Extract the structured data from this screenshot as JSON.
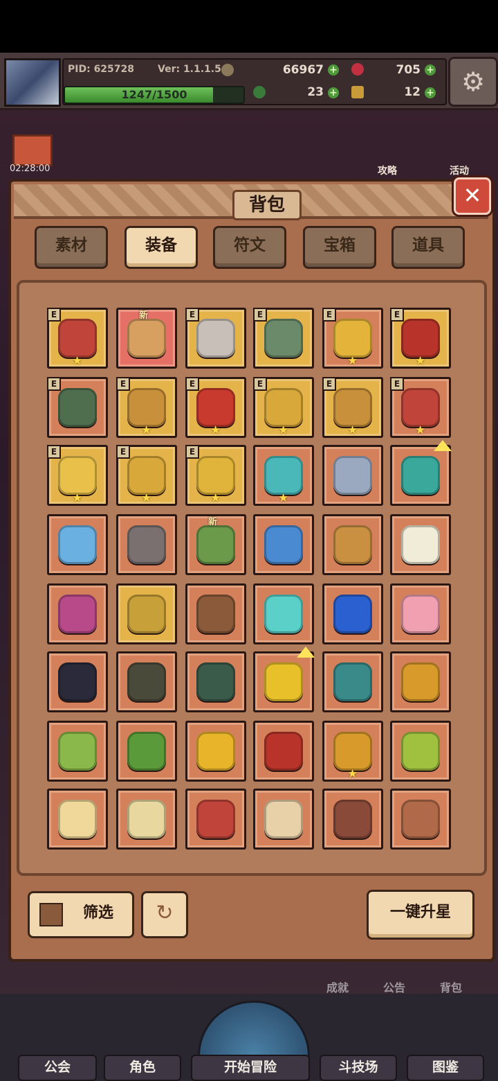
{
  "status": {
    "pid": "PID: 625728",
    "version": "Ver: 1.1.1.5",
    "gold": "66967",
    "gems": "705",
    "clover": "23",
    "keys": "12",
    "exp_text": "1247/1500",
    "exp_progress": 0.831
  },
  "hud": {
    "timer": "02:28:00",
    "guide": "攻略",
    "event": "活动"
  },
  "bag": {
    "title": "背包",
    "close_symbol": "✕"
  },
  "tabs": [
    {
      "label": "素材",
      "active": false
    },
    {
      "label": "装备",
      "active": true
    },
    {
      "label": "符文",
      "active": false
    },
    {
      "label": "宝箱",
      "active": false
    },
    {
      "label": "道具",
      "active": false
    }
  ],
  "items": [
    {
      "rarity": "gold",
      "icon": "helmet-red-icon",
      "color": "#c0443a",
      "e": true,
      "new": false,
      "star": true,
      "up": false
    },
    {
      "rarity": "pink",
      "icon": "ring-icon",
      "color": "#d8a060",
      "e": false,
      "new": true,
      "star": false,
      "up": false
    },
    {
      "rarity": "gold",
      "icon": "axe-icon",
      "color": "#c8c0b8",
      "e": true,
      "new": false,
      "star": false,
      "up": false
    },
    {
      "rarity": "gold",
      "icon": "orb-green-icon",
      "color": "#6a8a6a",
      "e": true,
      "new": false,
      "star": false,
      "up": false
    },
    {
      "rarity": "orange",
      "icon": "crown-ring-icon",
      "color": "#e4b43a",
      "e": true,
      "new": false,
      "star": true,
      "up": false
    },
    {
      "rarity": "gold",
      "icon": "cape-red-icon",
      "color": "#b8342a",
      "e": true,
      "new": false,
      "star": true,
      "up": false
    },
    {
      "rarity": "orange",
      "icon": "armor-green-icon",
      "color": "#4e6e4e",
      "e": true,
      "new": false,
      "star": false,
      "up": false
    },
    {
      "rarity": "gold",
      "icon": "scepter-icon",
      "color": "#c8903a",
      "e": true,
      "new": false,
      "star": true,
      "up": false
    },
    {
      "rarity": "gold",
      "icon": "gauntlet-icon",
      "color": "#c83a2e",
      "e": true,
      "new": false,
      "star": true,
      "up": false
    },
    {
      "rarity": "gold",
      "icon": "necklace-icon",
      "color": "#d8a83a",
      "e": true,
      "new": false,
      "star": true,
      "up": false
    },
    {
      "rarity": "gold",
      "icon": "boots-gold-icon",
      "color": "#c8903a",
      "e": true,
      "new": false,
      "star": true,
      "up": false
    },
    {
      "rarity": "orange",
      "icon": "boots-red-icon",
      "color": "#c0443a",
      "e": true,
      "new": false,
      "star": true,
      "up": false
    },
    {
      "rarity": "gold",
      "icon": "amulet-icon",
      "color": "#e8c04a",
      "e": true,
      "new": false,
      "star": true,
      "up": false
    },
    {
      "rarity": "gold",
      "icon": "pendant-icon",
      "color": "#d8a83a",
      "e": true,
      "new": false,
      "star": true,
      "up": false
    },
    {
      "rarity": "gold",
      "icon": "gem-ring-icon",
      "color": "#e0b43a",
      "e": true,
      "new": false,
      "star": true,
      "up": false
    },
    {
      "rarity": "orange",
      "icon": "staff-teal-icon",
      "color": "#4ab8b8",
      "e": false,
      "new": false,
      "star": true,
      "up": false
    },
    {
      "rarity": "orange",
      "icon": "crossed-swords-icon",
      "color": "#9aa8c0",
      "e": false,
      "new": false,
      "star": false,
      "up": false
    },
    {
      "rarity": "orange",
      "icon": "bow-icon",
      "color": "#3aa89a",
      "e": false,
      "new": false,
      "star": false,
      "up": true
    },
    {
      "rarity": "orange",
      "icon": "wand-blue-icon",
      "color": "#6ab0e0",
      "e": false,
      "new": false,
      "star": false,
      "up": false
    },
    {
      "rarity": "orange",
      "icon": "crossbow-icon",
      "color": "#7a7070",
      "e": false,
      "new": false,
      "star": false,
      "up": false
    },
    {
      "rarity": "orange",
      "icon": "leaf-blade-icon",
      "color": "#6a9a4a",
      "e": false,
      "new": true,
      "star": false,
      "up": false
    },
    {
      "rarity": "orange",
      "icon": "wand-gem-icon",
      "color": "#4a8ad0",
      "e": false,
      "new": false,
      "star": false,
      "up": false
    },
    {
      "rarity": "orange",
      "icon": "spear-icon",
      "color": "#c89040",
      "e": false,
      "new": false,
      "star": false,
      "up": false
    },
    {
      "rarity": "orange",
      "icon": "shield-white-icon",
      "color": "#f0ecd8",
      "e": false,
      "new": false,
      "star": false,
      "up": false
    },
    {
      "rarity": "orange",
      "icon": "flower-shield-icon",
      "color": "#b84a8a",
      "e": false,
      "new": false,
      "star": false,
      "up": false
    },
    {
      "rarity": "gold",
      "icon": "tower-shield-icon",
      "color": "#c8a03a",
      "e": false,
      "new": false,
      "star": false,
      "up": false
    },
    {
      "rarity": "orange",
      "icon": "wood-shield-icon",
      "color": "#8a5a3a",
      "e": false,
      "new": false,
      "star": false,
      "up": false
    },
    {
      "rarity": "orange",
      "icon": "orb-cyan-icon",
      "color": "#5ad0c8",
      "e": false,
      "new": false,
      "star": false,
      "up": false
    },
    {
      "rarity": "orange",
      "icon": "planet-orb-icon",
      "color": "#2a60d0",
      "e": false,
      "new": false,
      "star": false,
      "up": false
    },
    {
      "rarity": "orange",
      "icon": "pig-hat-icon",
      "color": "#f0a0b0",
      "e": false,
      "new": false,
      "star": false,
      "up": false
    },
    {
      "rarity": "orange",
      "icon": "top-hat-icon",
      "color": "#2a2a3a",
      "e": false,
      "new": false,
      "star": false,
      "up": false
    },
    {
      "rarity": "orange",
      "icon": "dark-helm-icon",
      "color": "#4a4a3a",
      "e": false,
      "new": false,
      "star": false,
      "up": false
    },
    {
      "rarity": "orange",
      "icon": "hood-icon",
      "color": "#3a5a4a",
      "e": false,
      "new": false,
      "star": false,
      "up": false
    },
    {
      "rarity": "orange",
      "icon": "gold-hat-icon",
      "color": "#e8c02a",
      "e": false,
      "new": false,
      "star": false,
      "up": true
    },
    {
      "rarity": "orange",
      "icon": "teal-armor-icon",
      "color": "#3a8a8a",
      "e": false,
      "new": false,
      "star": false,
      "up": false
    },
    {
      "rarity": "orange",
      "icon": "gold-armor-icon",
      "color": "#d89a2a",
      "e": false,
      "new": false,
      "star": false,
      "up": false
    },
    {
      "rarity": "orange",
      "icon": "leaf-armor-icon",
      "color": "#8ab84a",
      "e": false,
      "new": false,
      "star": false,
      "up": false
    },
    {
      "rarity": "orange",
      "icon": "green-armor-icon",
      "color": "#5a9a3a",
      "e": false,
      "new": false,
      "star": false,
      "up": false
    },
    {
      "rarity": "orange",
      "icon": "gold-chest-icon",
      "color": "#e8b42a",
      "e": false,
      "new": false,
      "star": false,
      "up": false
    },
    {
      "rarity": "orange",
      "icon": "red-armor-icon",
      "color": "#b8342a",
      "e": false,
      "new": false,
      "star": false,
      "up": false
    },
    {
      "rarity": "orange",
      "icon": "gold-gauntlet-icon",
      "color": "#d89a2a",
      "e": false,
      "new": false,
      "star": true,
      "up": false
    },
    {
      "rarity": "orange",
      "icon": "green-bracer-icon",
      "color": "#a0c040",
      "e": false,
      "new": false,
      "star": false,
      "up": false
    },
    {
      "rarity": "orange",
      "icon": "scroll-icon",
      "color": "#f0d89a",
      "e": false,
      "new": false,
      "star": false,
      "up": false
    },
    {
      "rarity": "orange",
      "icon": "glove-white-icon",
      "color": "#e8d8a0",
      "e": false,
      "new": false,
      "star": false,
      "up": false
    },
    {
      "rarity": "orange",
      "icon": "red-bracer-icon",
      "color": "#c0443a",
      "e": false,
      "new": false,
      "star": false,
      "up": false
    },
    {
      "rarity": "orange",
      "icon": "bone-bracer-icon",
      "color": "#e8d0a8",
      "e": false,
      "new": false,
      "star": false,
      "up": false
    },
    {
      "rarity": "orange",
      "icon": "fur-bracer-icon",
      "color": "#8a4a3a",
      "e": false,
      "new": false,
      "star": false,
      "up": false
    },
    {
      "rarity": "orange",
      "icon": "bronze-ring-icon",
      "color": "#b06a4a",
      "e": false,
      "new": false,
      "star": false,
      "up": false
    }
  ],
  "badges": {
    "e": "E",
    "new": "新",
    "star": "★"
  },
  "controls": {
    "filter": "筛选",
    "refresh_symbol": "↻",
    "upgrade_all": "一键升星"
  },
  "hud_bottom": {
    "achievement": "成就",
    "notice": "公告",
    "bag": "背包"
  },
  "nav": {
    "guild": "公会",
    "character": "角色",
    "start": "开始冒险",
    "arena": "斗技场",
    "codex": "图鉴"
  }
}
